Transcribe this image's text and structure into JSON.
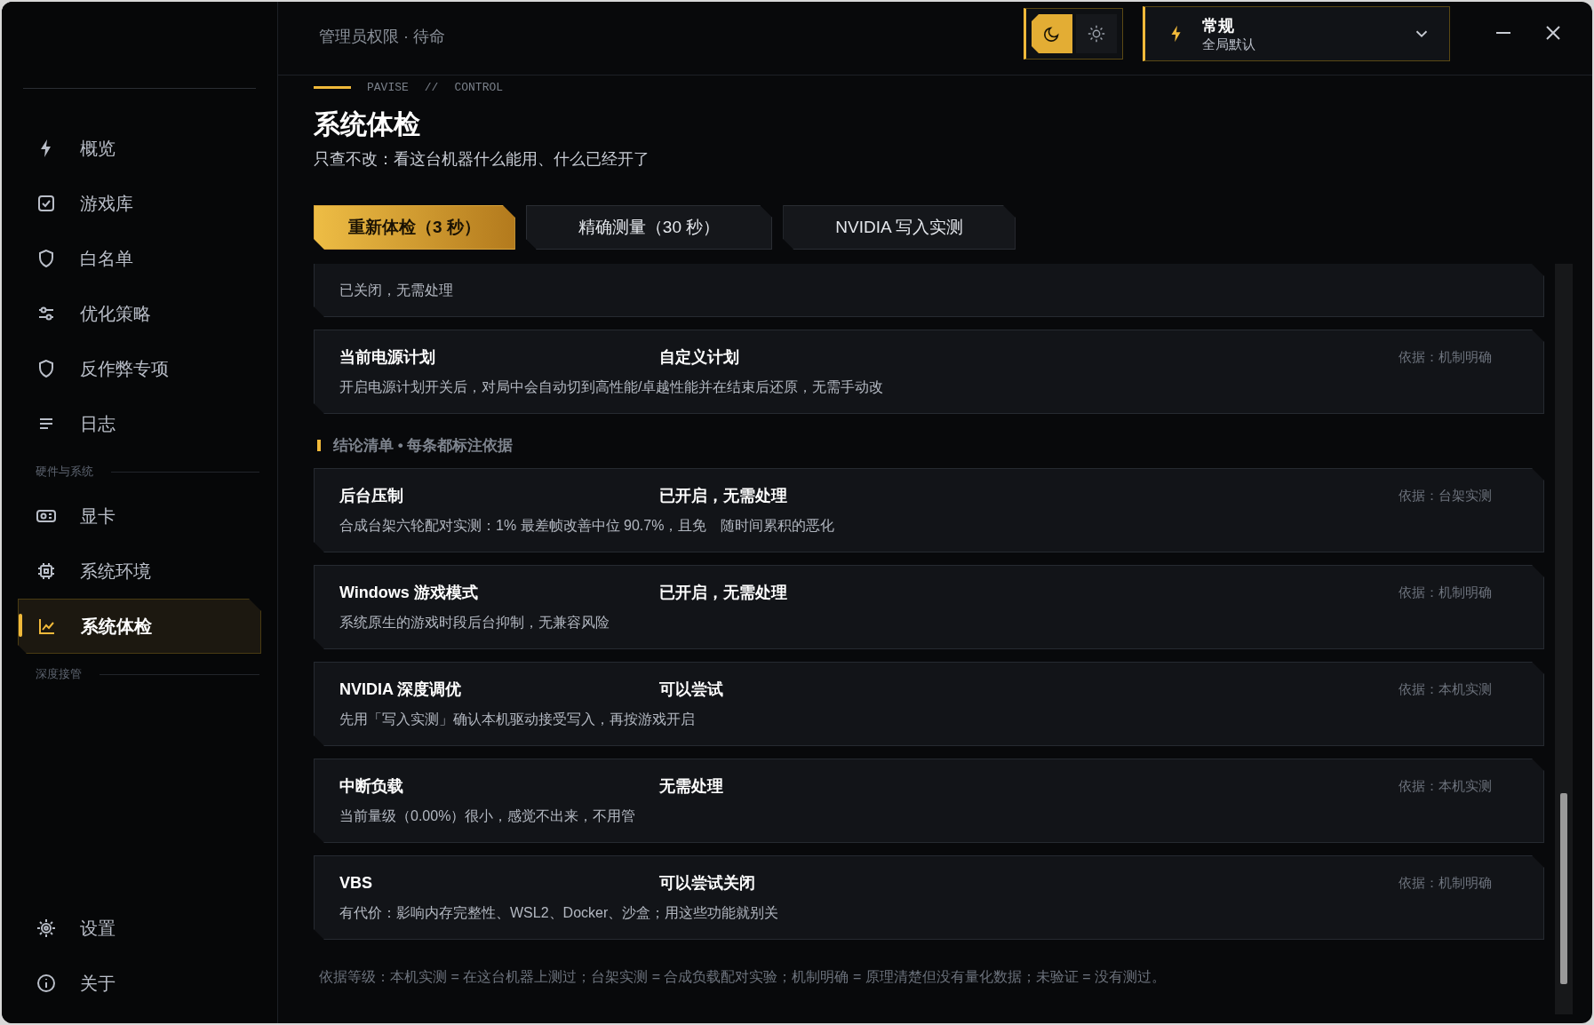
{
  "status": "管理员权限 · 待命",
  "theme_toggle": [
    {
      "selected": true
    },
    {
      "selected": false
    }
  ],
  "mode_select": {
    "title": "常规",
    "subtitle": "全局默认"
  },
  "sidebar": {
    "sections": [
      {
        "items": [
          {
            "label": "概览",
            "selected": false
          },
          {
            "label": "游戏库",
            "selected": false
          },
          {
            "label": "白名单",
            "selected": false
          },
          {
            "label": "优化策略",
            "selected": false
          },
          {
            "label": "反作弊专项",
            "selected": false
          },
          {
            "label": "日志",
            "selected": false
          }
        ]
      },
      {
        "heading": "硬件与系统",
        "items": [
          {
            "label": "显卡",
            "selected": false
          },
          {
            "label": "系统环境",
            "selected": false
          },
          {
            "label": "系统体检",
            "selected": true
          }
        ]
      },
      {
        "heading": "深度接管"
      }
    ],
    "footer_items": [
      {
        "label": "设置"
      },
      {
        "label": "关于"
      }
    ]
  },
  "breadcrumb": [
    "PAVISE",
    "//",
    "CONTROL"
  ],
  "title": "系统体检",
  "subtitle": "只查不改：看这台机器什么能用、什么已经开了",
  "actions": [
    {
      "label": "重新体检（3 秒）",
      "kind": "primary"
    },
    {
      "label": "精确测量（30 秒）",
      "kind": "secondary"
    },
    {
      "label": "NVIDIA 写入实测",
      "kind": "secondary"
    }
  ],
  "cards_before": [
    {
      "description": "已关闭，无需处理"
    },
    {
      "name": "当前电源计划",
      "status": "自定义计划",
      "basis": "依据：机制明确",
      "description": "开启电源计划开关后，对局中会自动切到高性能/卓越性能并在结束后还原，无需手动改"
    }
  ],
  "section_heading": "结论清单 • 每条都标注依据",
  "findings": [
    {
      "name": "后台压制",
      "status": "已开启，无需处理",
      "basis": "依据：台架实测",
      "description": "合成台架六轮配对实测：1% 最差帧改善中位 90.7%，且免　随时间累积的恶化"
    },
    {
      "name": "Windows 游戏模式",
      "status": "已开启，无需处理",
      "basis": "依据：机制明确",
      "description": "系统原生的游戏时段后台抑制，无兼容风险"
    },
    {
      "name": "NVIDIA 深度调优",
      "status": "可以尝试",
      "basis": "依据：本机实测",
      "description": "先用「写入实测」确认本机驱动接受写入，再按游戏开启"
    },
    {
      "name": "中断负载",
      "status": "无需处理",
      "basis": "依据：本机实测",
      "description": "当前量级（0.00%）很小，感觉不出来，不用管"
    },
    {
      "name": "VBS",
      "status": "可以尝试关闭",
      "basis": "依据：机制明确",
      "description": "有代价：影响内存完整性、WSL2、Docker、沙盒；用这些功能就别关"
    }
  ],
  "footnote": "依据等级：本机实测 = 在这台机器上测过；台架实测 = 合成负载配对实验；机制明确 = 原理清楚但没有量化数据；未验证 = 没有测过。"
}
